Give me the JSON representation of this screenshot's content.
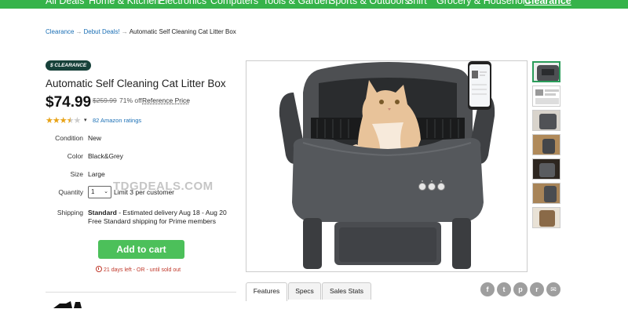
{
  "nav": {
    "items": [
      "All Deals",
      "Home & Kitchen",
      "Electronics",
      "Computers",
      "Tools & Garden",
      "Sports & Outdoors",
      "Shirt",
      "Grocery & Household",
      "Clearance"
    ]
  },
  "breadcrumb": {
    "items": [
      "Clearance",
      "Debut Deals!"
    ],
    "current": "Automatic Self Cleaning Cat Litter Box",
    "separator": "→"
  },
  "product": {
    "badge": "$ CLEARANCE",
    "title": "Automatic Self Cleaning Cat Litter Box",
    "price": "$74.99",
    "was_price": "$259.99",
    "discount": "71% off",
    "reference_label": "Reference Price",
    "rating": 3.5,
    "rating_caret": "▾",
    "ratings_link": "82 Amazon ratings"
  },
  "attributes": {
    "condition_label": "Condition",
    "condition_value": "New",
    "color_label": "Color",
    "color_value": "Black&Grey",
    "size_label": "Size",
    "size_value": "Large",
    "quantity_label": "Quantity",
    "quantity_value": "1",
    "quantity_limit": "Limit 3 per customer",
    "shipping_label": "Shipping",
    "shipping_method": "Standard",
    "shipping_estimate": " - Estimated delivery Aug 18 - Aug 20",
    "shipping_note": "Free Standard shipping for Prime members"
  },
  "cart": {
    "button_label": "Add to cart",
    "timer_text": "21 days left - OR - until sold out"
  },
  "gallery": {
    "watermark": "TDGDEALS.COM",
    "thumb_count": 7
  },
  "tabs": [
    "Features",
    "Specs",
    "Sales Stats"
  ],
  "share_icons": [
    "facebook-icon",
    "twitter-icon",
    "pinterest-icon",
    "reddit-icon",
    "email-icon"
  ],
  "colors": {
    "nav_green": "#36b34a",
    "cart_green": "#4cc05a",
    "badge_bg": "#17413a",
    "link_blue": "#1a6fb5",
    "star": "#e8a317",
    "timer_red": "#c0392b"
  }
}
